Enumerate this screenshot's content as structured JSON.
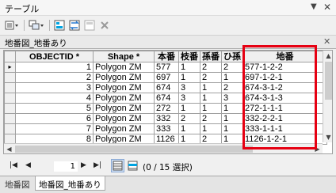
{
  "window": {
    "title": "テーブル"
  },
  "toolbar": {
    "icons": [
      "table-options-icon",
      "related-tables-icon",
      "select-by-attributes-icon",
      "switch-selection-icon",
      "clear-selection-icon",
      "delete-selected-icon"
    ]
  },
  "table_tab": {
    "label": "地番図_地番あり"
  },
  "grid": {
    "columns": [
      "",
      "OBJECTID *",
      "Shape *",
      "本番",
      "枝番",
      "孫番",
      "ひ孫",
      "地番"
    ],
    "rows": [
      {
        "marker": "▸",
        "objectid": "1",
        "shape": "Polygon ZM",
        "honban": "577",
        "edaban": "1",
        "magoban": "2",
        "himago": "2",
        "chiban": "577-1-2-2"
      },
      {
        "marker": "",
        "objectid": "2",
        "shape": "Polygon ZM",
        "honban": "697",
        "edaban": "1",
        "magoban": "2",
        "himago": "1",
        "chiban": "697-1-2-1"
      },
      {
        "marker": "",
        "objectid": "3",
        "shape": "Polygon ZM",
        "honban": "674",
        "edaban": "3",
        "magoban": "1",
        "himago": "2",
        "chiban": "674-3-1-2"
      },
      {
        "marker": "",
        "objectid": "4",
        "shape": "Polygon ZM",
        "honban": "674",
        "edaban": "3",
        "magoban": "1",
        "himago": "3",
        "chiban": "674-3-1-3"
      },
      {
        "marker": "",
        "objectid": "5",
        "shape": "Polygon ZM",
        "honban": "272",
        "edaban": "1",
        "magoban": "1",
        "himago": "1",
        "chiban": "272-1-1-1"
      },
      {
        "marker": "",
        "objectid": "6",
        "shape": "Polygon ZM",
        "honban": "332",
        "edaban": "2",
        "magoban": "2",
        "himago": "1",
        "chiban": "332-2-2-1"
      },
      {
        "marker": "",
        "objectid": "7",
        "shape": "Polygon ZM",
        "honban": "333",
        "edaban": "1",
        "magoban": "1",
        "himago": "1",
        "chiban": "333-1-1-1"
      },
      {
        "marker": "",
        "objectid": "8",
        "shape": "Polygon ZM",
        "honban": "1126",
        "edaban": "1",
        "magoban": "2",
        "himago": "1",
        "chiban": "1126-1-2-1"
      }
    ]
  },
  "navigator": {
    "current_record": "1",
    "status": "(0 / 15 選択)"
  },
  "bottom_tabs": [
    "地番図",
    "地番図_地番あり"
  ],
  "colors": {
    "highlight_box": "#e60012",
    "view_button_active": "#cfe0f5"
  }
}
